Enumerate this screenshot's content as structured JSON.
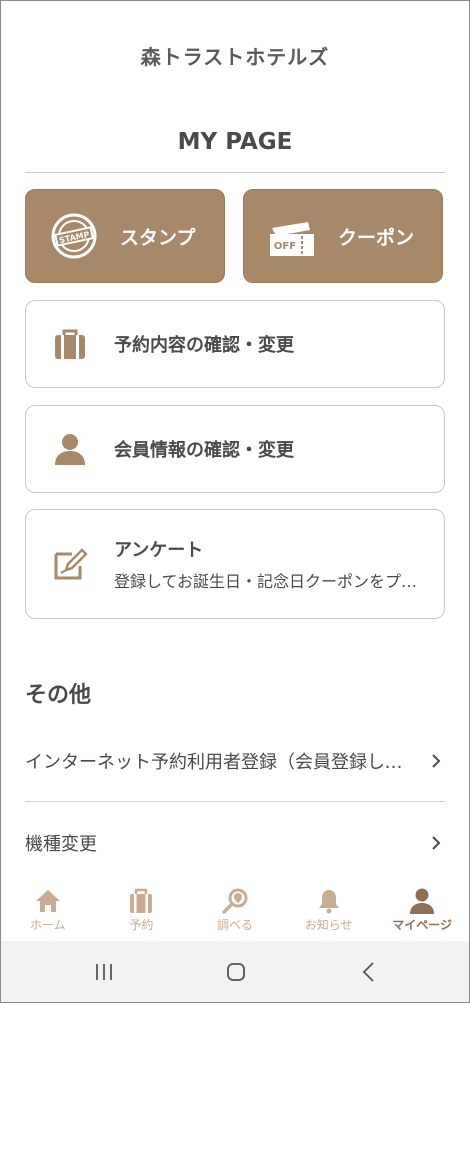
{
  "app": {
    "brand": "森トラストホテルズ"
  },
  "page": {
    "title": "MY PAGE"
  },
  "actions": {
    "stamp_label": "スタンプ",
    "stamp_icon_text": "STAMP",
    "coupon_label": "クーポン",
    "coupon_icon_text": "OFF"
  },
  "cards": {
    "reservation": {
      "title": "予約内容の確認・変更",
      "icon": "briefcase-icon"
    },
    "member": {
      "title": "会員情報の確認・変更",
      "icon": "user-icon"
    },
    "survey": {
      "title": "アンケート",
      "subtitle": "登録してお誕生日・記念日クーポンをプレゼント",
      "icon": "edit-note-icon"
    }
  },
  "other": {
    "section_title": "その他",
    "items": [
      {
        "label": "インターネット予約利用者登録（会員登録してからご利用ください）"
      },
      {
        "label": "機種変更"
      }
    ]
  },
  "tabbar": {
    "items": [
      {
        "label": "ホーム",
        "icon": "home-icon",
        "active": false
      },
      {
        "label": "予約",
        "icon": "briefcase-icon",
        "active": false
      },
      {
        "label": "調べる",
        "icon": "search-location-icon",
        "active": false
      },
      {
        "label": "お知らせ",
        "icon": "bell-icon",
        "active": false
      },
      {
        "label": "マイページ",
        "icon": "user-icon",
        "active": true
      }
    ]
  },
  "colors": {
    "accent": "#a7896a",
    "tab_inactive": "#c9ad93",
    "tab_active": "#8d7055",
    "text": "#4a4a4a"
  }
}
